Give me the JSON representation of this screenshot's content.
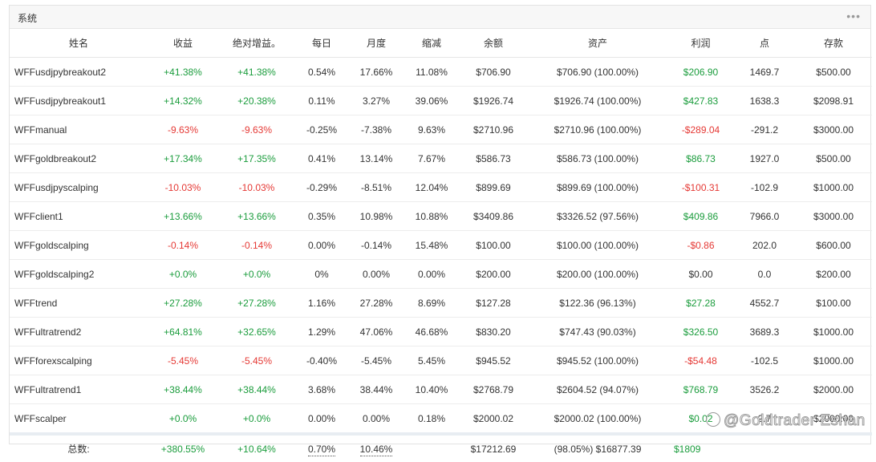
{
  "panel": {
    "title": "系统",
    "menu_icon": "more-dots-icon"
  },
  "columns": [
    "姓名",
    "收益",
    "绝对增益。",
    "每日",
    "月度",
    "缩减",
    "余额",
    "资产",
    "利润",
    "点",
    "存款"
  ],
  "rows": [
    {
      "name": "WFFusdjpybreakout2",
      "gain": "+41.38%",
      "abs_gain": "+41.38%",
      "daily": "0.54%",
      "monthly": "17.66%",
      "drawdown": "11.08%",
      "balance": "$706.90",
      "equity": "$706.90 (100.00%)",
      "profit": "$206.90",
      "pips": "1469.7",
      "deposits": "$500.00",
      "sign": "pos"
    },
    {
      "name": "WFFusdjpybreakout1",
      "gain": "+14.32%",
      "abs_gain": "+20.38%",
      "daily": "0.11%",
      "monthly": "3.27%",
      "drawdown": "39.06%",
      "balance": "$1926.74",
      "equity": "$1926.74 (100.00%)",
      "profit": "$427.83",
      "pips": "1638.3",
      "deposits": "$2098.91",
      "sign": "pos"
    },
    {
      "name": "WFFmanual",
      "gain": "-9.63%",
      "abs_gain": "-9.63%",
      "daily": "-0.25%",
      "monthly": "-7.38%",
      "drawdown": "9.63%",
      "balance": "$2710.96",
      "equity": "$2710.96 (100.00%)",
      "profit": "-$289.04",
      "pips": "-291.2",
      "deposits": "$3000.00",
      "sign": "neg"
    },
    {
      "name": "WFFgoldbreakout2",
      "gain": "+17.34%",
      "abs_gain": "+17.35%",
      "daily": "0.41%",
      "monthly": "13.14%",
      "drawdown": "7.67%",
      "balance": "$586.73",
      "equity": "$586.73 (100.00%)",
      "profit": "$86.73",
      "pips": "1927.0",
      "deposits": "$500.00",
      "sign": "pos"
    },
    {
      "name": "WFFusdjpyscalping",
      "gain": "-10.03%",
      "abs_gain": "-10.03%",
      "daily": "-0.29%",
      "monthly": "-8.51%",
      "drawdown": "12.04%",
      "balance": "$899.69",
      "equity": "$899.69 (100.00%)",
      "profit": "-$100.31",
      "pips": "-102.9",
      "deposits": "$1000.00",
      "sign": "neg"
    },
    {
      "name": "WFFclient1",
      "gain": "+13.66%",
      "abs_gain": "+13.66%",
      "daily": "0.35%",
      "monthly": "10.98%",
      "drawdown": "10.88%",
      "balance": "$3409.86",
      "equity": "$3326.52 (97.56%)",
      "profit": "$409.86",
      "pips": "7966.0",
      "deposits": "$3000.00",
      "sign": "pos"
    },
    {
      "name": "WFFgoldscalping",
      "gain": "-0.14%",
      "abs_gain": "-0.14%",
      "daily": "0.00%",
      "monthly": "-0.14%",
      "drawdown": "15.48%",
      "balance": "$100.00",
      "equity": "$100.00 (100.00%)",
      "profit": "-$0.86",
      "pips": "202.0",
      "deposits": "$600.00",
      "sign": "neg"
    },
    {
      "name": "WFFgoldscalping2",
      "gain": "+0.0%",
      "abs_gain": "+0.0%",
      "daily": "0%",
      "monthly": "0.00%",
      "drawdown": "0.00%",
      "balance": "$200.00",
      "equity": "$200.00 (100.00%)",
      "profit": "$0.00",
      "pips": "0.0",
      "deposits": "$200.00",
      "sign": "zero"
    },
    {
      "name": "WFFtrend",
      "gain": "+27.28%",
      "abs_gain": "+27.28%",
      "daily": "1.16%",
      "monthly": "27.28%",
      "drawdown": "8.69%",
      "balance": "$127.28",
      "equity": "$122.36 (96.13%)",
      "profit": "$27.28",
      "pips": "4552.7",
      "deposits": "$100.00",
      "sign": "pos"
    },
    {
      "name": "WFFultratrend2",
      "gain": "+64.81%",
      "abs_gain": "+32.65%",
      "daily": "1.29%",
      "monthly": "47.06%",
      "drawdown": "46.68%",
      "balance": "$830.20",
      "equity": "$747.43 (90.03%)",
      "profit": "$326.50",
      "pips": "3689.3",
      "deposits": "$1000.00",
      "sign": "pos"
    },
    {
      "name": "WFFforexscalping",
      "gain": "-5.45%",
      "abs_gain": "-5.45%",
      "daily": "-0.40%",
      "monthly": "-5.45%",
      "drawdown": "5.45%",
      "balance": "$945.52",
      "equity": "$945.52 (100.00%)",
      "profit": "-$54.48",
      "pips": "-102.5",
      "deposits": "$1000.00",
      "sign": "neg"
    },
    {
      "name": "WFFultratrend1",
      "gain": "+38.44%",
      "abs_gain": "+38.44%",
      "daily": "3.68%",
      "monthly": "38.44%",
      "drawdown": "10.40%",
      "balance": "$2768.79",
      "equity": "$2604.52 (94.07%)",
      "profit": "$768.79",
      "pips": "3526.2",
      "deposits": "$2000.00",
      "sign": "pos"
    },
    {
      "name": "WFFscalper",
      "gain": "+0.0%",
      "abs_gain": "+0.0%",
      "daily": "0.00%",
      "monthly": "0.00%",
      "drawdown": "0.18%",
      "balance": "$2000.02",
      "equity": "$2000.02 (100.00%)",
      "profit": "$0.02",
      "pips": "2.7",
      "deposits": "$2000.00",
      "sign": "pos"
    }
  ],
  "total": {
    "label": "总数:",
    "gain": "+380.55%",
    "abs_gain": "+10.64%",
    "daily": "0.70%",
    "monthly": "10.46%",
    "drawdown": "",
    "balance": "$17212.69",
    "equity": "(98.05%) $16877.39",
    "profit": "$1809",
    "pips": "",
    "deposits": ""
  },
  "watermark": "@Goldtrader Eshan",
  "colors": {
    "positive": "#1a9c3c",
    "negative": "#e53935",
    "header_bg": "#f7f7f7"
  }
}
